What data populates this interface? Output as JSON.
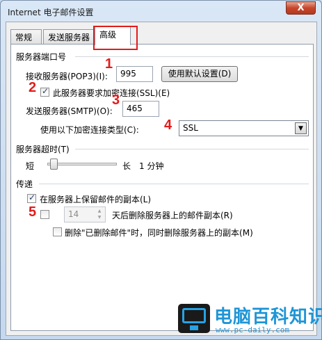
{
  "window": {
    "title": "Internet 电子邮件设置",
    "close_label": "X"
  },
  "tabs": [
    {
      "label": "常规"
    },
    {
      "label": "发送服务器"
    },
    {
      "label": "高级"
    }
  ],
  "server_ports": {
    "title": "服务器端口号",
    "incoming_label": "接收服务器(POP3)(I):",
    "incoming_value": "995",
    "default_button": "使用默认设置(D)",
    "ssl_checkbox_label": "此服务器要求加密连接(SSL)(E)",
    "ssl_checked": true,
    "outgoing_label": "发送服务器(SMTP)(O):",
    "outgoing_value": "465",
    "encryption_label": "使用以下加密连接类型(C):",
    "encryption_value": "SSL"
  },
  "timeout": {
    "title": "服务器超时(T)",
    "short_label": "短",
    "long_label": "长",
    "value_label": "1 分钟",
    "level": 0.05
  },
  "delivery": {
    "title": "传递",
    "leave_copy_label": "在服务器上保留邮件的副本(L)",
    "leave_copy_checked": true,
    "remove_after_value": "14",
    "remove_after_label": "天后删除服务器上的邮件副本(R)",
    "remove_after_checked": false,
    "remove_when_deleted_label": "删除\"已删除邮件\"时，同时删除服务器上的副本(M)",
    "remove_when_deleted_checked": false
  },
  "annotations": [
    "1",
    "2",
    "3",
    "4",
    "5"
  ],
  "watermark": {
    "text": "电脑百科知识",
    "url": "www.pc-daily.com"
  }
}
